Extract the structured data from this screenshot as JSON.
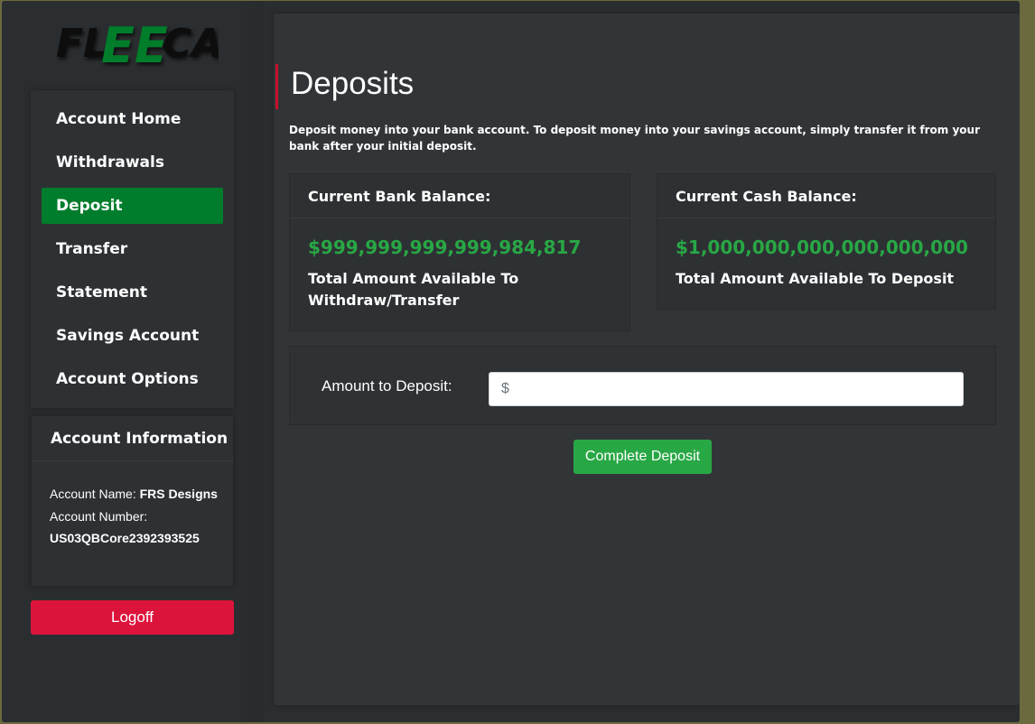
{
  "brand": {
    "logo_text_left": "FL",
    "logo_text_mid": "EE",
    "logo_text_right": "CA",
    "logo_color_dark": "#0a0a0a",
    "logo_color_green": "#007d2c"
  },
  "colors": {
    "accent_green": "#007d2c",
    "amount_green": "#28a745",
    "danger_red": "#dc143c",
    "title_bar_red": "#c8102e"
  },
  "sidebar": {
    "items": [
      {
        "label": "Account Home",
        "active": false
      },
      {
        "label": "Withdrawals",
        "active": false
      },
      {
        "label": "Deposit",
        "active": true
      },
      {
        "label": "Transfer",
        "active": false
      },
      {
        "label": "Statement",
        "active": false
      },
      {
        "label": "Savings Account",
        "active": false
      },
      {
        "label": "Account Options",
        "active": false
      }
    ],
    "account_info": {
      "title": "Account Information",
      "name_label": "Account Name:",
      "name_value": "FRS Designs",
      "number_label": "Account Number:",
      "number_value": "US03QBCore2392393525"
    },
    "logoff_label": "Logoff"
  },
  "main": {
    "title": "Deposits",
    "description": "Deposit money into your bank account. To deposit money into your savings account, simply transfer it from your bank after your initial deposit.",
    "bank_card": {
      "header": "Current Bank Balance:",
      "amount": "$999,999,999,999,984,817",
      "caption": "Total Amount Available To Withdraw/Transfer"
    },
    "cash_card": {
      "header": "Current Cash Balance:",
      "amount": "$1,000,000,000,000,000,000",
      "caption": "Total Amount Available To Deposit"
    },
    "form": {
      "amount_label": "Amount to Deposit:",
      "amount_placeholder": "$",
      "amount_value": "",
      "submit_label": "Complete Deposit"
    }
  }
}
